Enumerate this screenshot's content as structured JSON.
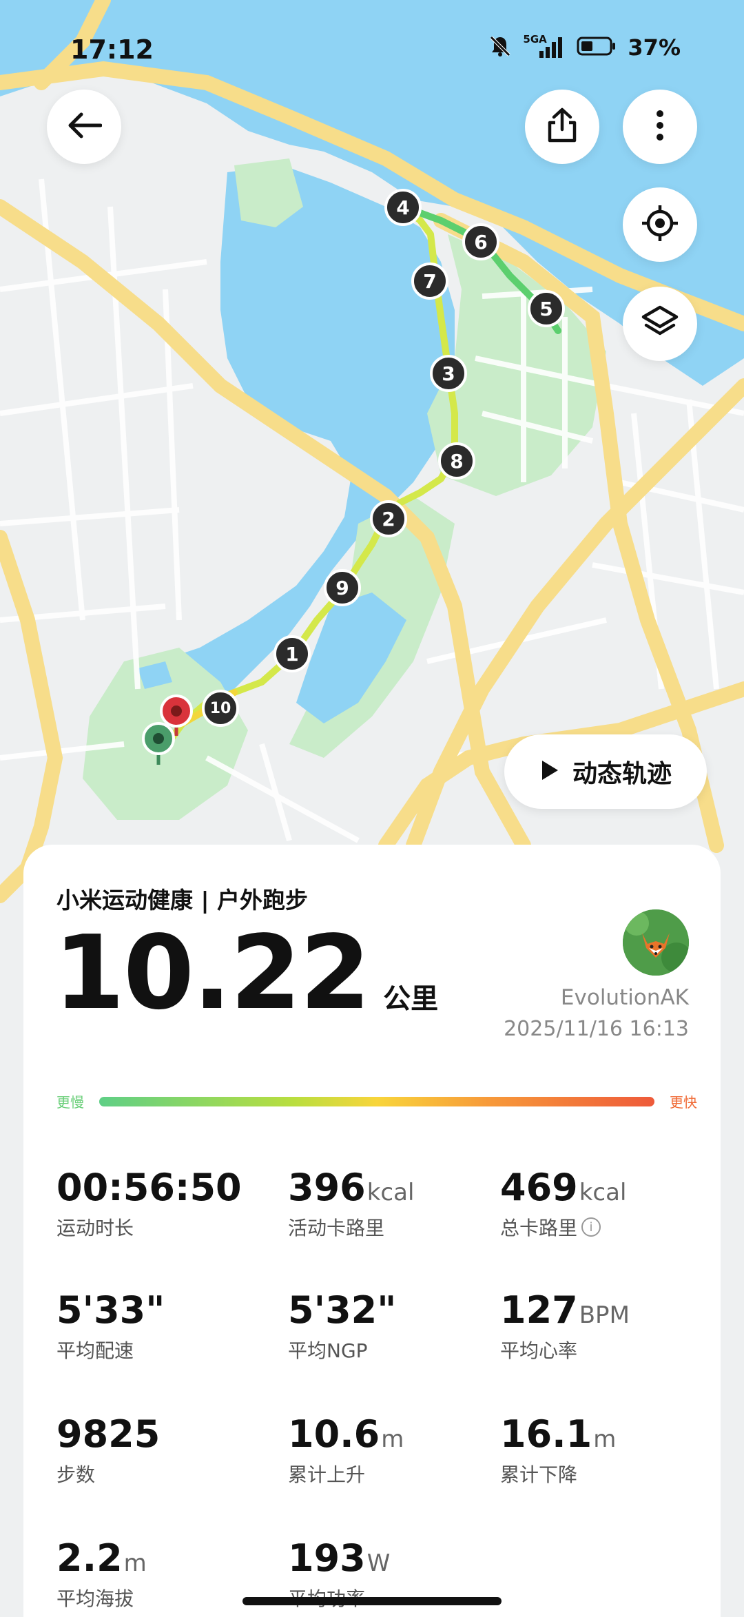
{
  "status_bar": {
    "time": "17:12",
    "network": "5GA",
    "battery": "37%"
  },
  "map": {
    "route_markers": [
      "1",
      "2",
      "3",
      "4",
      "5",
      "6",
      "7",
      "8",
      "9",
      "10"
    ],
    "icons": {
      "back": "back-arrow-icon",
      "share": "share-icon",
      "more": "more-vertical-icon",
      "locate": "locate-icon",
      "layers": "layers-icon"
    },
    "track_button_label": "动态轨迹"
  },
  "summary": {
    "title": "小米运动健康 | 户外跑步",
    "distance": "10.22",
    "distance_unit": "公里",
    "username": "EvolutionAK",
    "datetime": "2025/11/16 16:13",
    "pace_slow_label": "更慢",
    "pace_fast_label": "更快"
  },
  "stats": [
    {
      "value": "00:56:50",
      "unit": "",
      "label": "运动时长"
    },
    {
      "value": "396",
      "unit": "kcal",
      "label": "活动卡路里"
    },
    {
      "value": "469",
      "unit": "kcal",
      "label": "总卡路里"
    },
    {
      "value": "5'33\"",
      "unit": "",
      "label": "平均配速"
    },
    {
      "value": "5'32\"",
      "unit": "",
      "label": "平均NGP"
    },
    {
      "value": "127",
      "unit": "BPM",
      "label": "平均心率"
    },
    {
      "value": "9825",
      "unit": "",
      "label": "步数"
    },
    {
      "value": "10.6",
      "unit": "m",
      "label": "累计上升"
    },
    {
      "value": "16.1",
      "unit": "m",
      "label": "累计下降"
    },
    {
      "value": "2.2",
      "unit": "m",
      "label": "平均海拔"
    },
    {
      "value": "193",
      "unit": "W",
      "label": "平均功率"
    }
  ],
  "colors": {
    "water": "#8fd3f4",
    "park": "#c9ecc9",
    "road": "#f7dd8a",
    "route_start": "#4a9d6a",
    "route_end": "#d9333b"
  }
}
